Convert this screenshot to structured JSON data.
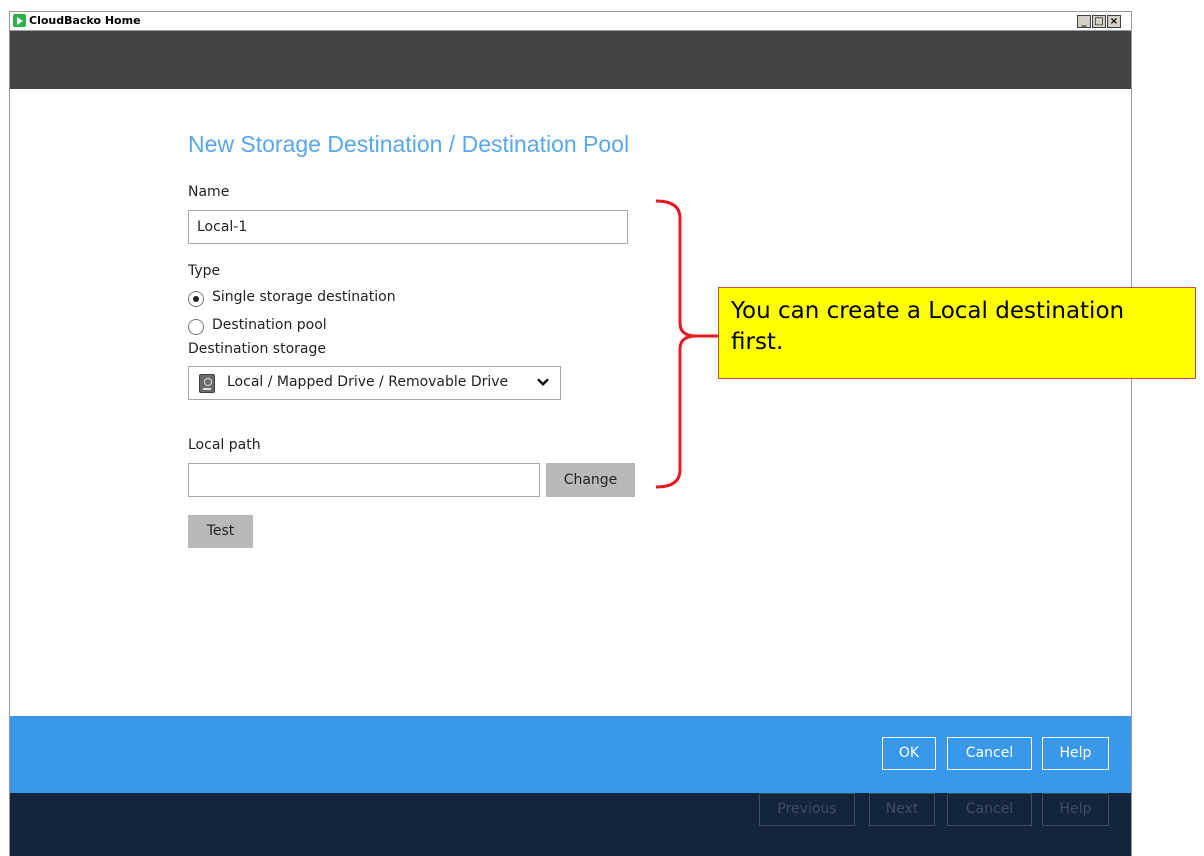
{
  "window": {
    "title": "CloudBacko Home",
    "controls": {
      "minimize": "_",
      "maximize": "□",
      "close": "×"
    }
  },
  "form": {
    "page_title": "New Storage Destination / Destination Pool",
    "name_label": "Name",
    "name_value": "Local-1",
    "type_label": "Type",
    "type_options": [
      {
        "label": "Single storage destination",
        "selected": true
      },
      {
        "label": "Destination pool",
        "selected": false
      }
    ],
    "destination_storage_label": "Destination storage",
    "destination_storage_value": "Local / Mapped Drive / Removable Drive",
    "destination_storage_icon": "drive-icon",
    "local_path_label": "Local path",
    "local_path_value": "",
    "change_button": "Change",
    "test_button": "Test"
  },
  "footer": {
    "ok_button": "OK",
    "cancel_button": "Cancel",
    "help_button": "Help"
  },
  "wizard_footer": {
    "previous_button": "Previous",
    "next_button": "Next",
    "cancel_button": "Cancel",
    "help_button": "Help"
  },
  "annotation": {
    "callout_text": "You can create a Local destination first.",
    "colors": {
      "bracket": "#e31b23",
      "callout_bg": "#ffff00"
    }
  },
  "colors": {
    "accent_blue": "#3a98ea",
    "title_blue": "#58a7ec",
    "header_gray": "#434343",
    "footer_navy": "#13253c"
  }
}
